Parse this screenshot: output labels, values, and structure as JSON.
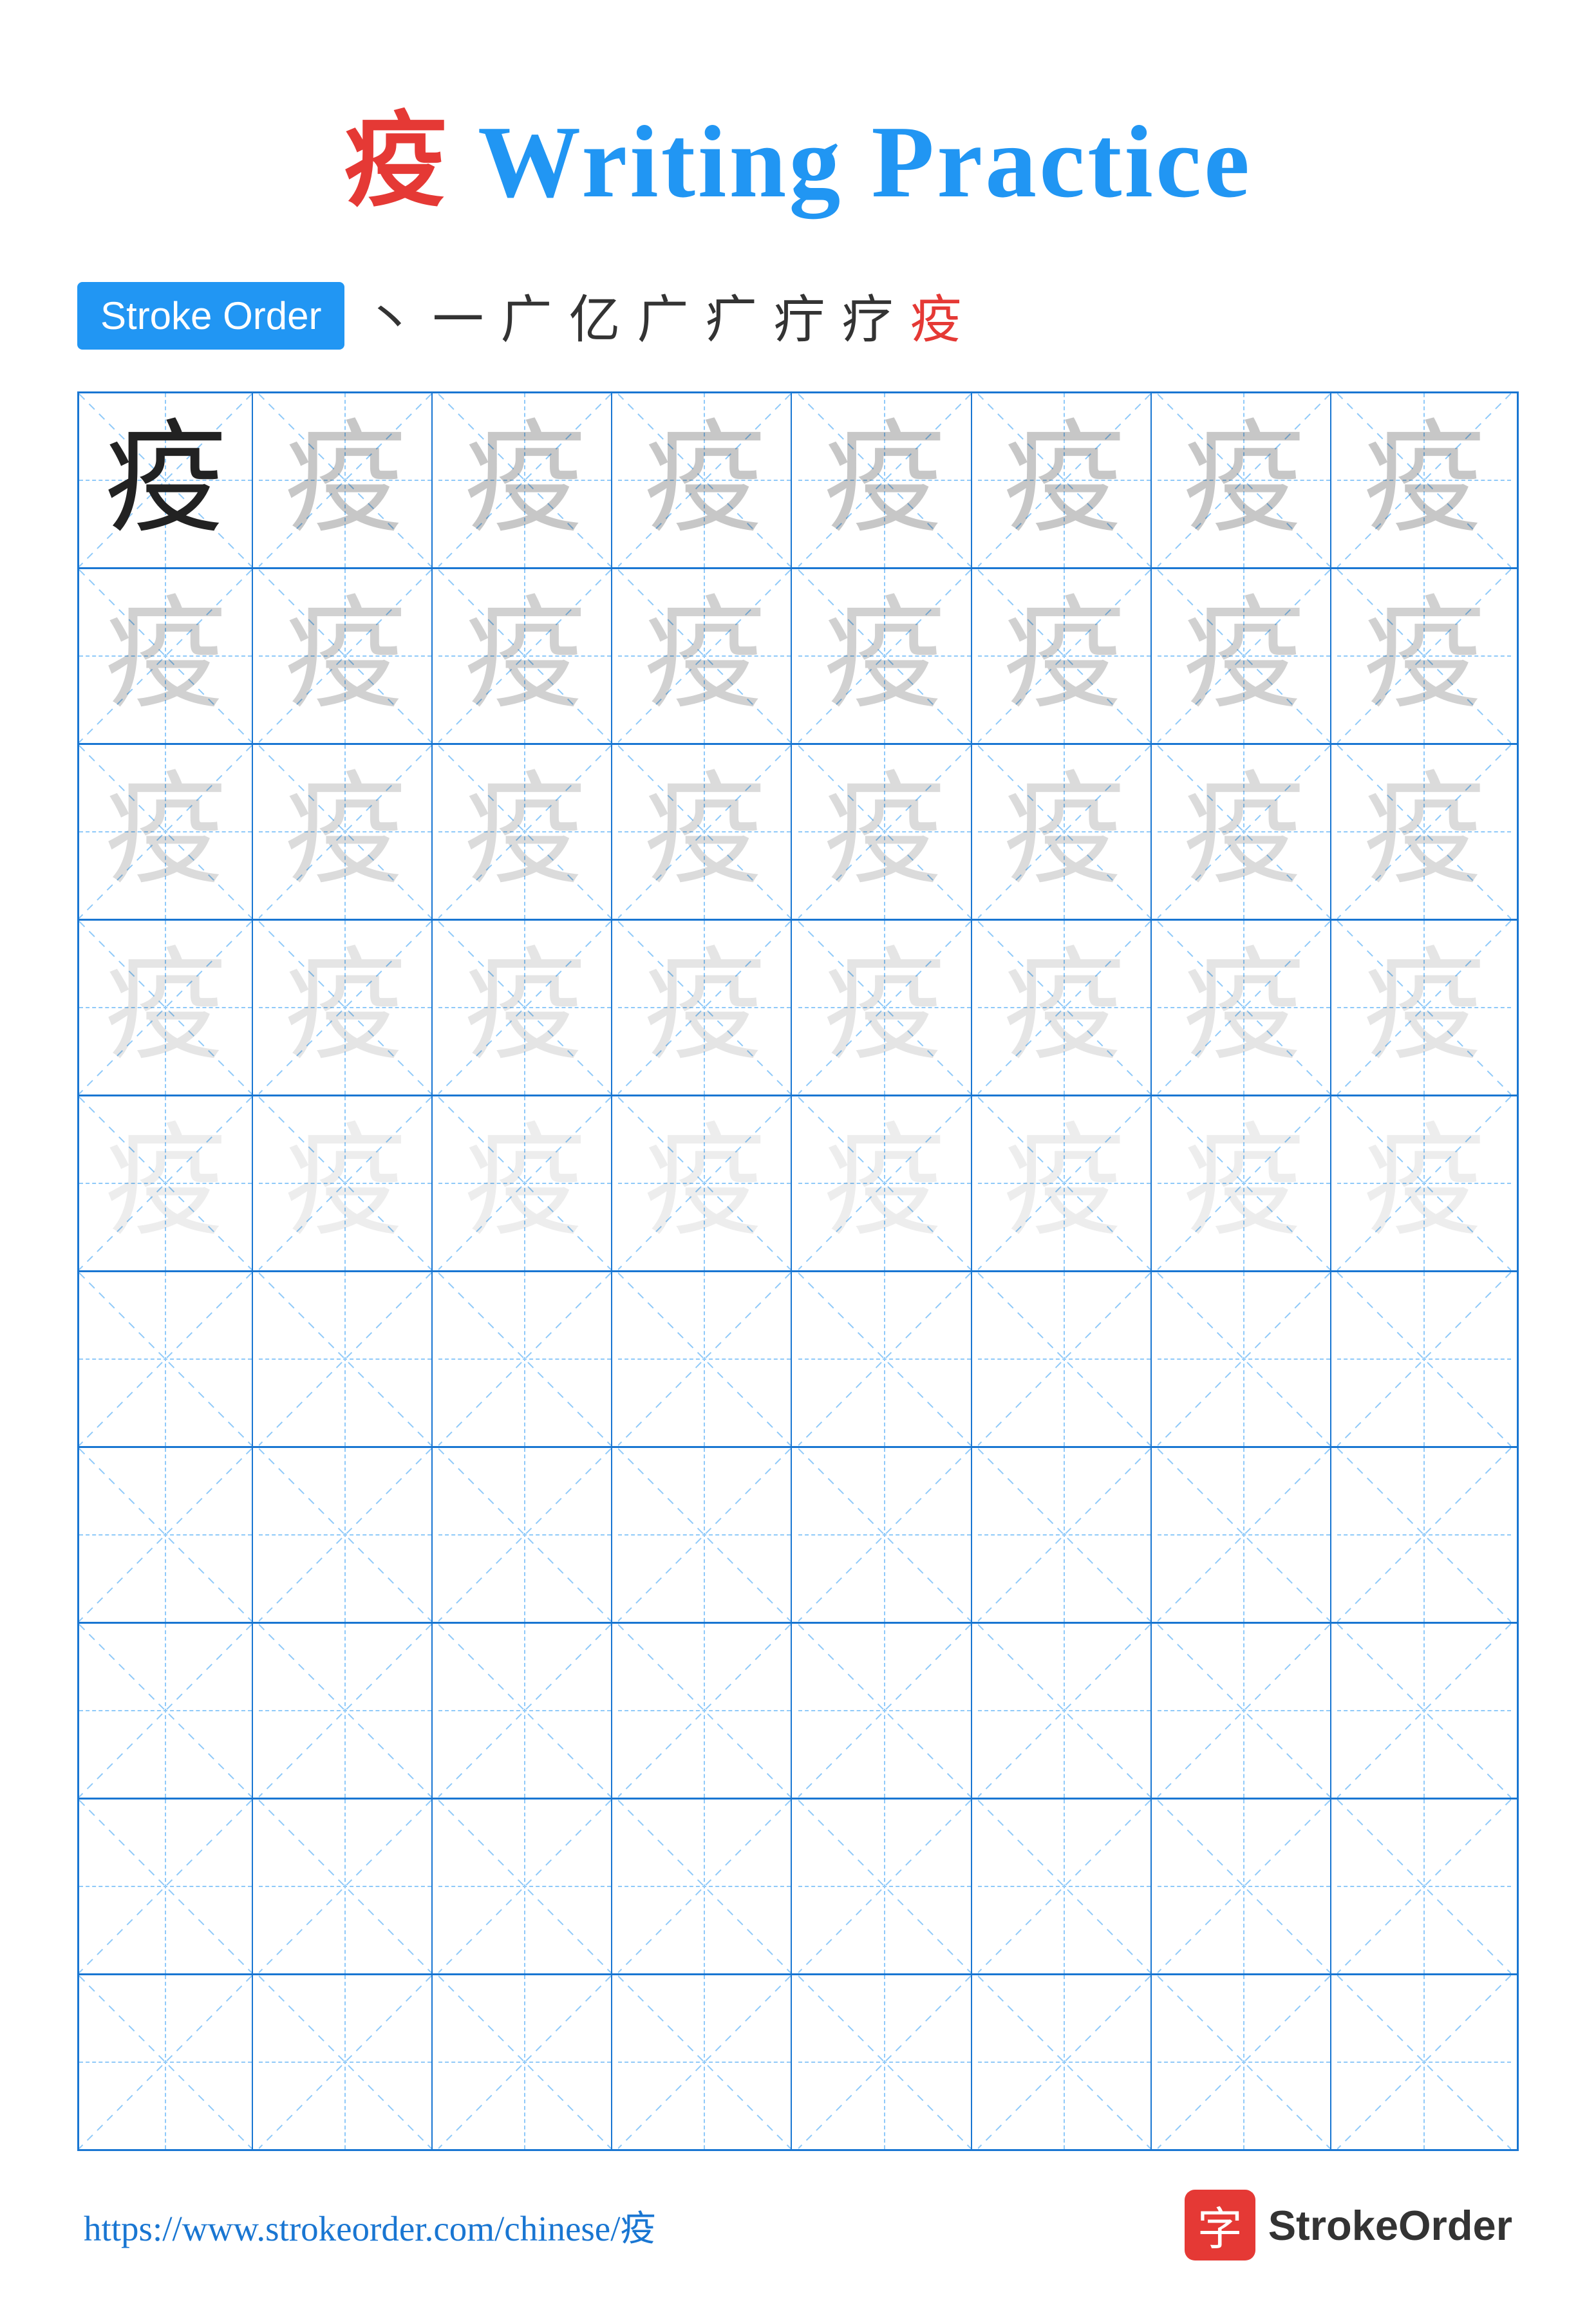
{
  "title": {
    "char": "疫",
    "text": " Writing Practice",
    "full": "疫 Writing Practice"
  },
  "stroke_order": {
    "badge_label": "Stroke Order",
    "strokes": [
      "丶",
      "一",
      "广",
      "亿",
      "广",
      "疒",
      "疔",
      "疗",
      "疫"
    ]
  },
  "grid": {
    "cols": 8,
    "rows": 10,
    "char": "疫",
    "practice_rows": 5,
    "empty_rows": 5,
    "row_opacities": [
      1,
      0.22,
      0.15,
      0.1,
      0.07
    ]
  },
  "footer": {
    "url": "https://www.strokeorder.com/chinese/疫",
    "logo_char": "字",
    "logo_text": "StrokeOrder"
  }
}
